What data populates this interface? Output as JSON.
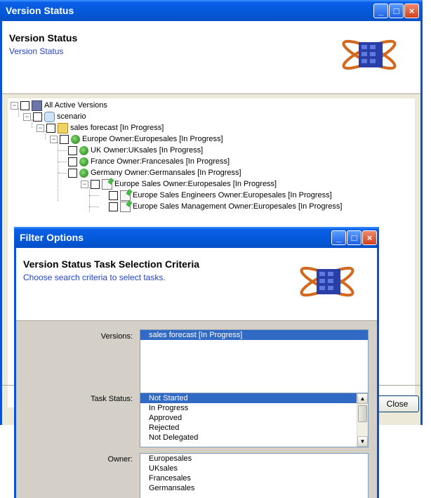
{
  "vs_window": {
    "title": "Version Status",
    "header_title": "Version Status",
    "header_subtitle": "Version Status",
    "close_button_label": "Close",
    "tree": [
      {
        "label": "All Active Versions",
        "icon": "network-icon",
        "expander": "−"
      },
      {
        "label": "scenario",
        "icon": "database-icon",
        "expander": "−"
      },
      {
        "label": "sales forecast [In Progress]",
        "icon": "folder-icon",
        "expander": "−"
      },
      {
        "label": "Europe Owner:Europesales [In Progress]",
        "icon": "globe-icon",
        "expander": "−"
      },
      {
        "label": "UK Owner:UKsales [In Progress]",
        "icon": "globe-icon"
      },
      {
        "label": "France Owner:Francesales [In Progress]",
        "icon": "globe-icon"
      },
      {
        "label": "Germany Owner:Germansales [In Progress]",
        "icon": "globe-icon"
      },
      {
        "label": "Europe Sales Owner:Europesales [In Progress]",
        "icon": "document-edit-icon",
        "expander": "−"
      },
      {
        "label": "Europe Sales Engineers Owner:Europesales [In Progress]",
        "icon": "document-edit-icon"
      },
      {
        "label": "Europe Sales Management Owner:Europesales [In Progress]",
        "icon": "document-edit-icon"
      }
    ]
  },
  "fo_window": {
    "title": "Filter Options",
    "header_title": "Version Status Task Selection Criteria",
    "header_subtitle": "Choose search criteria to select tasks.",
    "versions_label": "Versions:",
    "versions": [
      "sales forecast [In Progress]"
    ],
    "task_status_label": "Task Status:",
    "task_status": [
      "Not Started",
      "In Progress",
      "Approved",
      "Rejected",
      "Not Delegated"
    ],
    "owner_label": "Owner:",
    "owners": [
      "Europesales",
      "UKsales",
      "Francesales",
      "Germansales"
    ]
  },
  "colors": {
    "titlebar": "#0358d8",
    "selection": "#316ac5",
    "subtitle": "#2244cc"
  }
}
